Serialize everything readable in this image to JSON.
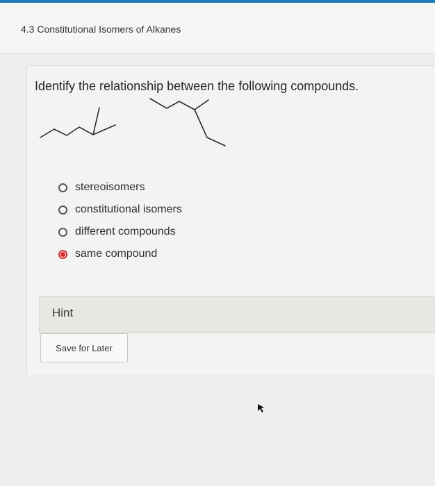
{
  "header": {
    "section_title": "4.3 Constitutional Isomers of Alkanes"
  },
  "question": {
    "prompt": "Identify the relationship between the following compounds."
  },
  "options": [
    {
      "label": "stereoisomers",
      "selected": false
    },
    {
      "label": "constitutional isomers",
      "selected": false
    },
    {
      "label": "different compounds",
      "selected": false
    },
    {
      "label": "same compound",
      "selected": true
    }
  ],
  "hint": {
    "label": "Hint"
  },
  "actions": {
    "save_label": "Save for Later"
  },
  "colors": {
    "accent": "#1f7bb8",
    "selected_radio": "#d22d2d"
  }
}
